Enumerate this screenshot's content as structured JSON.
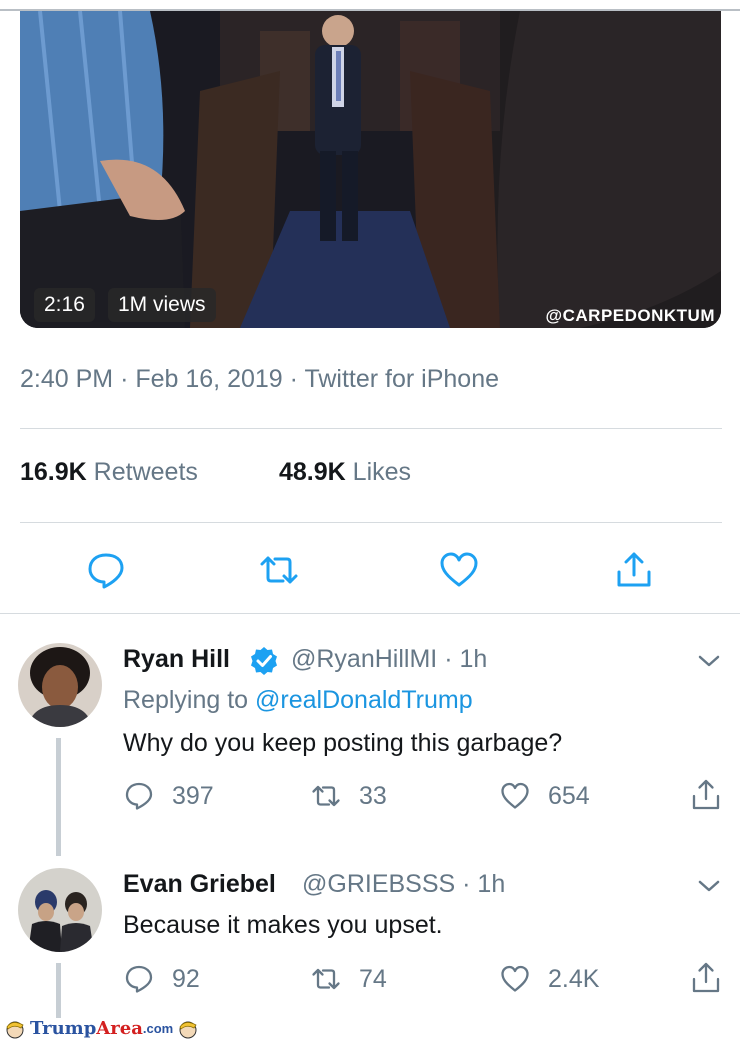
{
  "video": {
    "duration": "2:16",
    "views": "1M views",
    "watermark": "@CARPEDONKTUM"
  },
  "tweet_meta": {
    "time": "2:40 PM",
    "date": "Feb 16, 2019",
    "source": "Twitter for iPhone",
    "separator": "·"
  },
  "stats": {
    "retweets_count": "16.9K",
    "retweets_label": "Retweets",
    "likes_count": "48.9K",
    "likes_label": "Likes"
  },
  "replies": [
    {
      "name": "Ryan Hill",
      "handle": "@RyanHillMI",
      "time": "· 1h",
      "replying_prefix": "Replying to",
      "replying_to": "@realDonaldTrump",
      "text": "Why do you keep posting this garbage?",
      "reply_count": "397",
      "retweet_count": "33",
      "like_count": "654"
    },
    {
      "name": "Evan Griebel",
      "handle": "@GRIEBSSS",
      "time": "· 1h",
      "text": "Because it makes you upset.",
      "reply_count": "92",
      "retweet_count": "74",
      "like_count": "2.4K"
    }
  ],
  "site_watermark": {
    "part1": "Trump",
    "part2": "Area",
    "suffix": ".com"
  },
  "colors": {
    "link": "#1b95e0",
    "secondary_text": "#657786",
    "verified": "#1da1f2"
  }
}
